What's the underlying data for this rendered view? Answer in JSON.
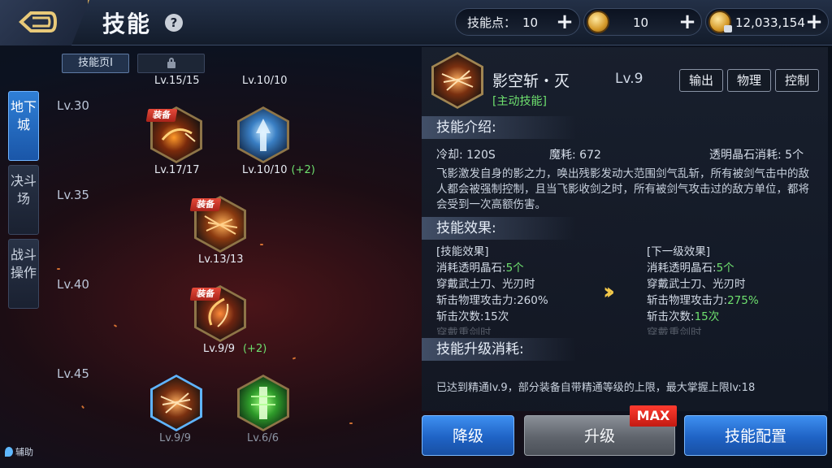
{
  "header": {
    "title": "技能",
    "skill_points_label": "技能点：",
    "skill_points": "10",
    "coins": "10",
    "gold": "12,033,154"
  },
  "side_tabs": [
    "地下城",
    "决斗场",
    "战斗操作"
  ],
  "assist_label": "辅助",
  "page_tabs": {
    "active": "技能页Ⅰ"
  },
  "level_rows": [
    "Lv.30",
    "Lv.35",
    "Lv.40",
    "Lv.45"
  ],
  "equip_label": "装备",
  "skills": {
    "top_left": {
      "level": "Lv.15/15"
    },
    "top_right": {
      "level": "Lv.10/10"
    },
    "s30_a": {
      "level": "Lv.17/17",
      "equipped": true
    },
    "s30_b": {
      "level": "Lv.10/10",
      "bonus": "(+2)"
    },
    "s35_a": {
      "level": "Lv.13/13",
      "equipped": true
    },
    "s40_a": {
      "level": "Lv.9/9",
      "bonus": "(+2)",
      "equipped": true
    },
    "s45_a": {
      "level": "Lv.9/9",
      "selected": true
    },
    "s45_b": {
      "level": "Lv.6/6"
    }
  },
  "detail": {
    "name": "影空斩・灭",
    "level": "Lv.9",
    "type": "[主动技能]",
    "tags": [
      "输出",
      "物理",
      "控制"
    ],
    "intro_title": "技能介绍:",
    "cooldown": "冷却: 120S",
    "mana": "魔耗: 672",
    "crystal": "透明晶石消耗: 5个",
    "description": "飞影激发自身的影之力，唤出残影发动大范围剑气乱斩，所有被剑气击中的敌人都会被强制控制，且当飞影收剑之时，所有被剑气攻击过的敌方单位，都将会受到一次高额伤害。",
    "effect_title": "技能效果:",
    "current": {
      "header": "[技能效果]",
      "line1_label": "消耗透明晶石:",
      "line1_value": "5个",
      "line2": "穿戴武士刀、光刃时",
      "line3_label": "斩击物理攻击力:",
      "line3_value": "260%",
      "line4_label": "斩击次数:",
      "line4_value": "15次",
      "line5": "穿戴重剑时"
    },
    "next": {
      "header": "[下一级效果]",
      "line1_label": "消耗透明晶石:",
      "line1_value": "5个",
      "line2": "穿戴武士刀、光刃时",
      "line3_label": "斩击物理攻击力:",
      "line3_value": "275%",
      "line4_label": "斩击次数:",
      "line4_value": "15次",
      "line5": "穿戴重剑时"
    },
    "upgrade_title": "技能升级消耗:",
    "upgrade_note": "已达到精通lv.9，部分装备自带精通等级的上限，最大掌握上限lv:18"
  },
  "buttons": {
    "downgrade": "降级",
    "upgrade": "升级",
    "max_badge": "MAX",
    "config": "技能配置"
  },
  "colors": {
    "accent_blue": "#2f7fd6",
    "green": "#6ee06e",
    "gold": "#c7a15a",
    "max_red": "#ff3b2f"
  }
}
